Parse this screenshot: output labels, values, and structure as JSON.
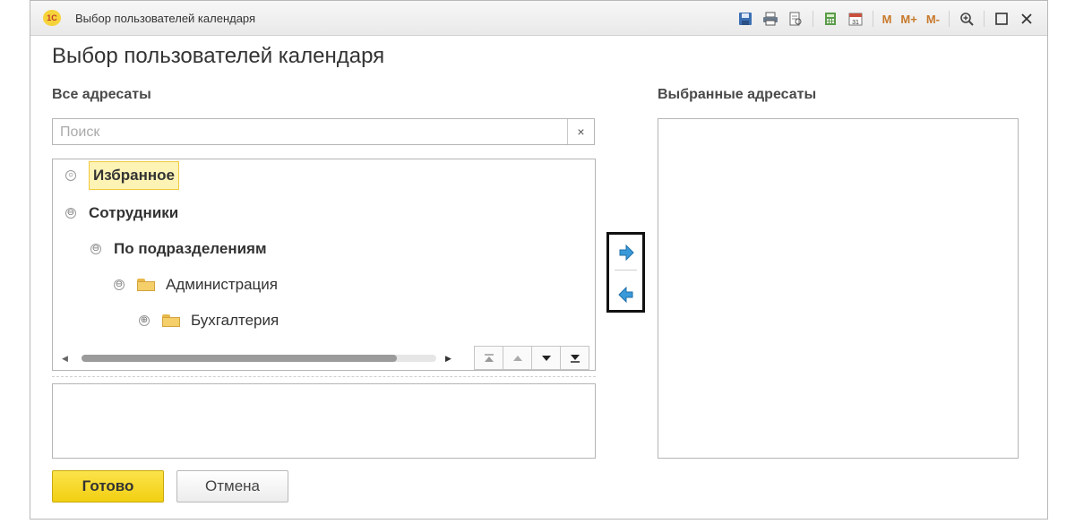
{
  "window": {
    "title": "Выбор пользователей календаря",
    "logo_text": "1С",
    "toolbar": {
      "icons": [
        "save-icon",
        "print-icon",
        "print-preview-icon",
        "calculator-icon",
        "calendar-icon"
      ],
      "calendar_day": "31",
      "m_label": "M",
      "m_plus_label": "M+",
      "m_minus_label": "M-"
    }
  },
  "form": {
    "title": "Выбор пользователей календаря",
    "left_label": "Все адресаты",
    "right_label": "Выбранные адресаты",
    "search": {
      "placeholder": "Поиск",
      "value": "",
      "clear_symbol": "×"
    },
    "tree": [
      {
        "label": "Избранное",
        "bold": true,
        "selected": true,
        "toggle": "○",
        "folder": false
      },
      {
        "label": "Сотрудники",
        "bold": true,
        "toggle": "⊖",
        "folder": false
      },
      {
        "label": "По подразделениям",
        "bold": true,
        "toggle": "⊖",
        "folder": false
      },
      {
        "label": "Администрация",
        "bold": false,
        "toggle": "⊖",
        "folder": true
      },
      {
        "label": "Бухгалтерия",
        "bold": false,
        "toggle": "⊕",
        "folder": true
      }
    ],
    "buttons": {
      "ok": "Готово",
      "cancel": "Отмена"
    }
  },
  "colors": {
    "primary_button": "#f2cf12",
    "arrow_blue": "#3a9ad9",
    "selection": "#fdf3b5"
  }
}
